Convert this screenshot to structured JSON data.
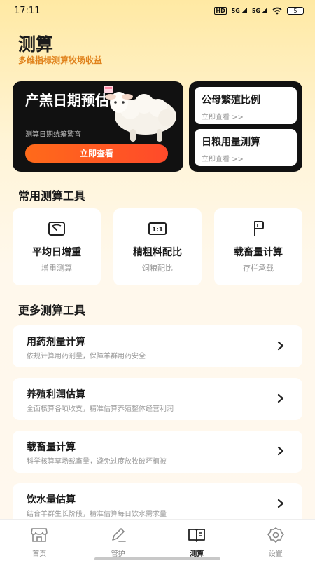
{
  "status": {
    "time": "17:11",
    "network1": "5G",
    "network2": "5G",
    "hd": "HD",
    "battery": "5"
  },
  "header": {
    "title": "测算",
    "subtitle": "多维指标测算牧场收益"
  },
  "banner": {
    "title": "产羔日期预估",
    "subtitle": "测算日期统筹繁育",
    "button": "立即查看"
  },
  "side_cards": [
    {
      "title": "公母繁殖比例",
      "sub": "立即查看 >>"
    },
    {
      "title": "日粮用量测算",
      "sub": "立即查看 >>"
    }
  ],
  "common_tools": {
    "title": "常用测算工具",
    "items": [
      {
        "name": "平均日增重",
        "sub": "增重测算",
        "icon": "scale-icon"
      },
      {
        "name": "精粗料配比",
        "sub": "饲粮配比",
        "icon": "ratio-icon",
        "icon_text": "1:1"
      },
      {
        "name": "载畜量计算",
        "sub": "存栏承载",
        "icon": "flag-icon"
      }
    ]
  },
  "more_tools": {
    "title": "更多测算工具",
    "items": [
      {
        "title": "用药剂量计算",
        "sub": "依规计算用药剂量，保障羊群用药安全"
      },
      {
        "title": "养殖利润估算",
        "sub": "全面核算各项收支，精准估算养殖整体经营利润"
      },
      {
        "title": "载畜量计算",
        "sub": "科学核算草场载畜量，避免过度放牧破坏植被"
      },
      {
        "title": "饮水量估算",
        "sub": "结合羊群生长阶段，精准估算每日饮水需求量"
      }
    ]
  },
  "tabbar": [
    {
      "label": "首页",
      "icon": "store-icon",
      "active": false
    },
    {
      "label": "管护",
      "icon": "pen-icon",
      "active": false
    },
    {
      "label": "测算",
      "icon": "book-icon",
      "active": true
    },
    {
      "label": "设置",
      "icon": "gear-icon",
      "active": false
    }
  ],
  "colors": {
    "accent": "#FF5A22",
    "subtitle": "#E0821C",
    "dark_card": "#111111"
  }
}
